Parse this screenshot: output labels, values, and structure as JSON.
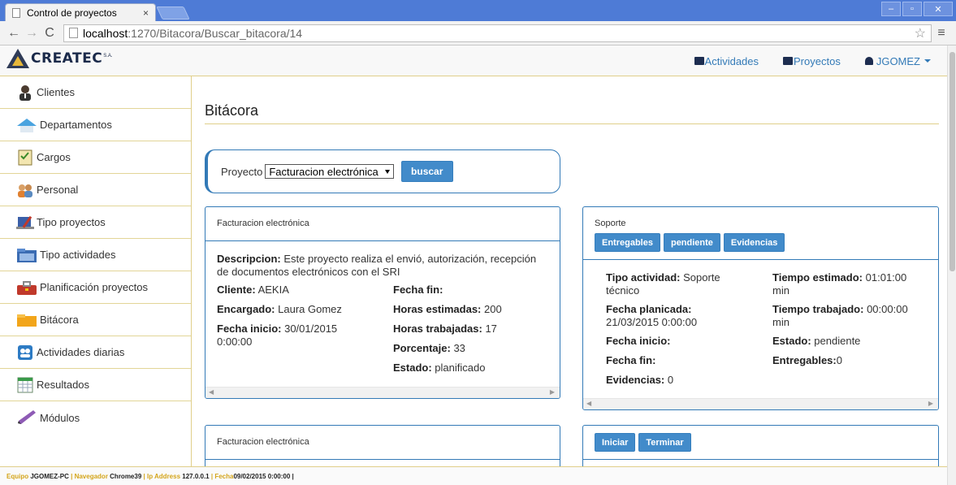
{
  "browser": {
    "tab_title": "Control de proyectos",
    "tab_close": "×",
    "url_host": "localhost",
    "url_path": ":1270/Bitacora/Buscar_bitacora/14",
    "window_controls": [
      "–",
      "▫",
      "✕"
    ]
  },
  "navbar": {
    "brand": "CREATEC",
    "brand_suffix": "S.A.",
    "links": [
      {
        "label": "Actividades",
        "icon": "activities-icon"
      },
      {
        "label": "Proyectos",
        "icon": "projects-icon"
      },
      {
        "label": "JGOMEZ",
        "icon": "user-icon"
      }
    ]
  },
  "sidebar": {
    "items": [
      {
        "label": "Clientes",
        "icon": "client-icon"
      },
      {
        "label": "Departamentos",
        "icon": "house-icon"
      },
      {
        "label": "Cargos",
        "icon": "checklist-icon"
      },
      {
        "label": "Personal",
        "icon": "people-icon"
      },
      {
        "label": "Tipo proyectos",
        "icon": "project-type-icon"
      },
      {
        "label": "Tipo actividades",
        "icon": "folder-blue-icon"
      },
      {
        "label": "Planificación proyectos",
        "icon": "toolbox-icon"
      },
      {
        "label": "Bitácora",
        "icon": "folder-icon"
      },
      {
        "label": "Actividades diarias",
        "icon": "daily-activities-icon"
      },
      {
        "label": "Resultados",
        "icon": "spreadsheet-icon"
      },
      {
        "label": "Módulos",
        "icon": "pencil-icon"
      }
    ]
  },
  "page": {
    "title": "Bitácora"
  },
  "search": {
    "label": "Proyecto",
    "selected": "Facturacion electrónica",
    "button": "buscar"
  },
  "project_panel": {
    "header": "Facturacion electrónica",
    "descripcion_label": "Descripcion:",
    "descripcion_line1": " Este proyecto realiza el envió, autorización, recepción",
    "descripcion_line2": "de documentos electrónicos con el SRI",
    "cliente_label": "Cliente:",
    "cliente": "AEKIA",
    "encargado_label": "Encargado:",
    "encargado": "Laura Gomez",
    "fecha_inicio_label": "Fecha inicio:",
    "fecha_inicio_1": "30/01/2015",
    "fecha_inicio_2": "0:00:00",
    "fecha_fin_label": "Fecha fin:",
    "horas_est_label": "Horas estimadas:",
    "horas_est": "200",
    "horas_trab_label": "Horas trabajadas:",
    "horas_trab": "17",
    "porcentaje_label": "Porcentaje:",
    "porcentaje": "33",
    "estado_label": "Estado:",
    "estado": "planificado"
  },
  "activity_panel": {
    "header": "Soporte",
    "buttons": [
      "Entregables",
      "pendiente",
      "Evidencias"
    ],
    "tipo_label": "Tipo actividad:",
    "tipo_1": "Soporte",
    "tipo_2": "técnico",
    "planicada_label": "Fecha planicada:",
    "planicada": "21/03/2015 0:00:00",
    "inicio_label": "Fecha inicio:",
    "fin_label": "Fecha fin:",
    "evidencias_label": "Evidencias:",
    "evidencias": "0",
    "t_est_label": "Tiempo estimado:",
    "t_est_1": "01:01:00",
    "t_est_2": "min",
    "t_trab_label": "Tiempo trabajado:",
    "t_trab_1": "00:00:00",
    "t_trab_2": "min",
    "estado_label": "Estado:",
    "estado": "pendiente",
    "entregables_label": "Entregables:",
    "entregables": "0"
  },
  "project_panel_2": {
    "header": "Facturacion electrónica"
  },
  "actions_panel": {
    "buttons": [
      "Iniciar",
      "Terminar"
    ]
  },
  "footer": {
    "equipo_label": "Equipo ",
    "equipo": "JGOMEZ-PC",
    "sep": " | ",
    "nav_label": "Navegador ",
    "nav": "Chrome39",
    "ip_label": "Ip Address ",
    "ip": "127.0.0.1",
    "fecha_label": "Fecha",
    "fecha": "09/02/2015 0:00:00",
    "end": " |"
  }
}
